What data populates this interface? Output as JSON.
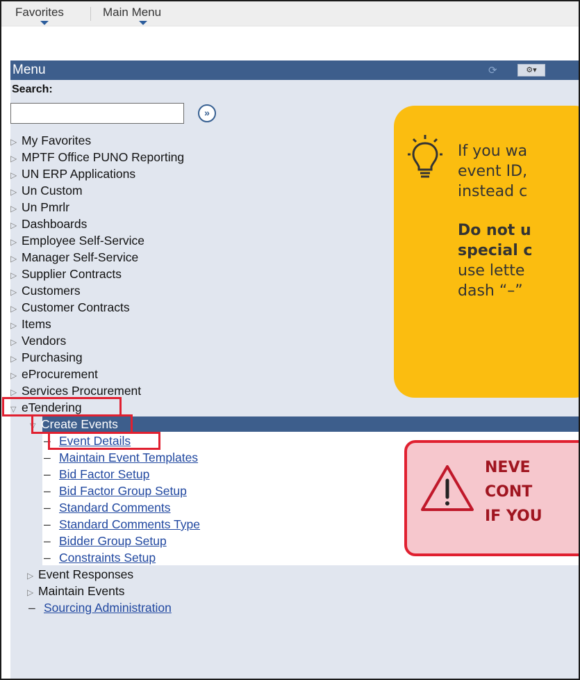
{
  "topnav": {
    "favorites": "Favorites",
    "main_menu": "Main Menu"
  },
  "menu": {
    "title": "Menu",
    "search_label": "Search:",
    "search_value": "",
    "search_go": "»",
    "refresh_icon": "⟳",
    "gear_button": "⚙▾",
    "items": [
      "My Favorites",
      "MPTF Office PUNO Reporting",
      "UN ERP Applications",
      "Un Custom",
      "Un Pmrlr",
      "Dashboards",
      "Employee Self-Service",
      "Manager Self-Service",
      "Supplier Contracts",
      "Customers",
      "Customer Contracts",
      "Items",
      "Vendors",
      "Purchasing",
      "eProcurement",
      "Services Procurement"
    ],
    "etendering": "eTendering",
    "create_events": "Create Events",
    "create_events_children": [
      "Event Details",
      "Maintain Event Templates",
      "Bid Factor Setup",
      "Bid Factor Group Setup",
      "Standard Comments",
      "Standard Comments Type",
      "Bidder Group Setup",
      "Constraints Setup"
    ],
    "event_responses": "Event Responses",
    "maintain_events": "Maintain Events",
    "sourcing_admin": "Sourcing Administration"
  },
  "tip": {
    "line1": "If you wa",
    "line2": "event ID,",
    "line3": "instead c",
    "line4": "Do not u",
    "line5": "special c",
    "line6": "use lette",
    "line7": "dash “–”"
  },
  "warning": {
    "line1": "NEVE",
    "line2": "CONT",
    "line3": "IF YOU"
  },
  "colors": {
    "header": "#3d5e8c",
    "panel": "#e1e6ef",
    "link": "#2148a0",
    "highlight": "#e02030",
    "tip_bg": "#fbbd10",
    "warn_bg": "#f6c7cd"
  }
}
